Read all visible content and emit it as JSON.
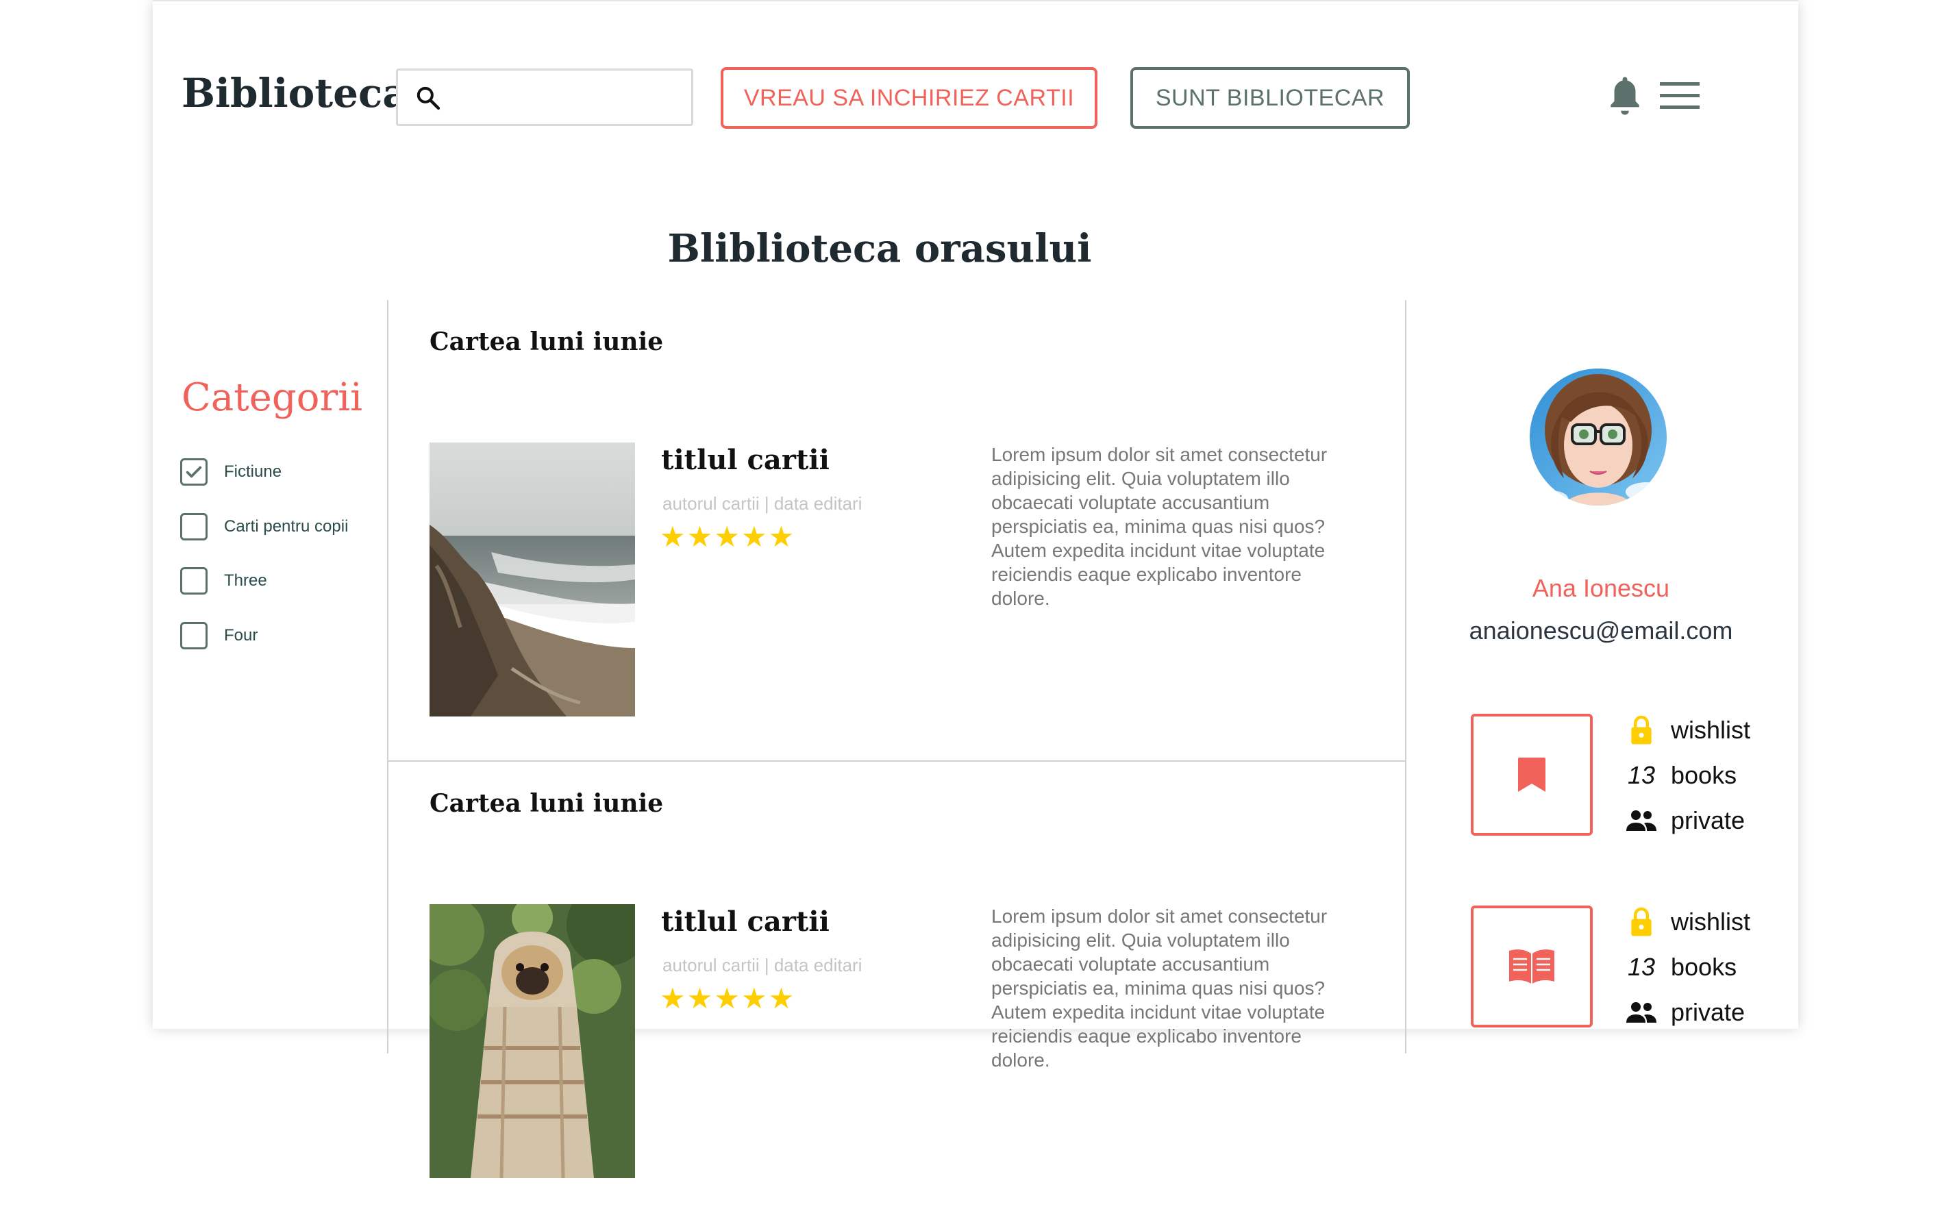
{
  "header": {
    "logo": "Biblioteca",
    "search": {
      "placeholder": "",
      "value": ""
    },
    "rent_button": "VREAU SA INCHIRIEZ CARTII",
    "librarian_button": "SUNT BIBLIOTECAR",
    "icons": [
      "search-icon",
      "bell-icon",
      "menu-icon"
    ]
  },
  "page_title": "Bliblioteca orasului",
  "categories": {
    "title": "Categorii",
    "items": [
      {
        "label": "Fictiune",
        "checked": true
      },
      {
        "label": "Carti pentru copii",
        "checked": false
      },
      {
        "label": "Three",
        "checked": false
      },
      {
        "label": "Four",
        "checked": false
      }
    ]
  },
  "cards": [
    {
      "heading": "Cartea luni iunie",
      "book_title": "titlul cartii",
      "meta": "autorul cartii | data editari",
      "rating": 5,
      "description": "Lorem ipsum dolor sit amet consectetur adipisicing elit. Quia voluptatem illo obcaecati voluptate accusantium perspiciatis ea, minima quas nisi quos? Autem expedita incidunt vitae voluptate reiciendis eaque explicabo inventore dolore."
    },
    {
      "heading": "Cartea luni iunie",
      "book_title": "titlul cartii",
      "meta": "autorul cartii | data editari",
      "rating": 5,
      "description": "Lorem ipsum dolor sit amet consectetur adipisicing elit. Quia voluptatem illo obcaecati voluptate accusantium perspiciatis ea, minima quas nisi quos? Autem expedita incidunt vitae voluptate reiciendis eaque explicabo inventore dolore."
    }
  ],
  "profile": {
    "name": "Ana Ionescu",
    "email": "anaionescu@email.com",
    "lists": [
      {
        "icon": "bookmark-icon",
        "type": "wishlist",
        "count": "13",
        "count_label": "books",
        "visibility": "private"
      },
      {
        "icon": "open-book-icon",
        "type": "wishlist",
        "count": "13",
        "count_label": "books",
        "visibility": "private"
      }
    ]
  },
  "colors": {
    "accent": "#f0625a",
    "secondary": "#5c716c",
    "star": "#ffce00",
    "text_dark": "#1f2a30"
  }
}
